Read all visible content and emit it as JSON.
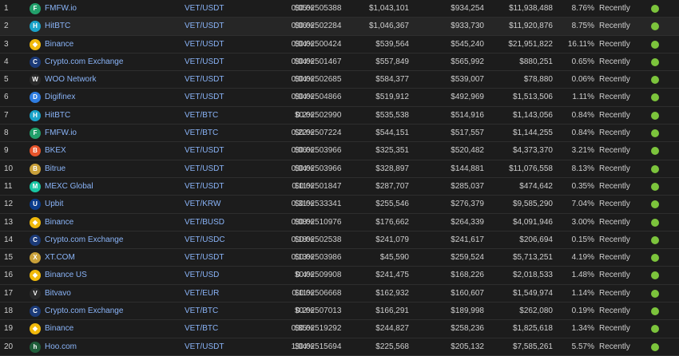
{
  "colors": {
    "accent_link": "#8ab4f8",
    "trust_green": "#7cc43c",
    "background": "#1c1c1c"
  },
  "rows": [
    {
      "rank": "1",
      "exchange": "FMFW.io",
      "icon": "fmfw-icon",
      "icon_color": "#22a06b",
      "icon_glyph": "F",
      "pair": "VET/USDT",
      "price": "$0.02505388",
      "spread": "0.05%",
      "depth_plus": "$1,043,101",
      "depth_minus": "$934,254",
      "volume": "$11,938,488",
      "volume_pct": "8.76%",
      "updated": "Recently"
    },
    {
      "rank": "2",
      "exchange": "HitBTC",
      "icon": "hitbtc-icon",
      "icon_color": "#1aa3c9",
      "icon_glyph": "H",
      "pair": "VET/USDT",
      "price": "$0.02502284",
      "spread": "0.06%",
      "depth_plus": "$1,046,367",
      "depth_minus": "$933,730",
      "volume": "$11,920,876",
      "volume_pct": "8.75%",
      "updated": "Recently"
    },
    {
      "rank": "3",
      "exchange": "Binance",
      "icon": "binance-icon",
      "icon_color": "#f0b90b",
      "icon_glyph": "◆",
      "pair": "VET/USDT",
      "price": "$0.02500424",
      "spread": "0.04%",
      "depth_plus": "$539,564",
      "depth_minus": "$545,240",
      "volume": "$21,951,822",
      "volume_pct": "16.11%",
      "updated": "Recently"
    },
    {
      "rank": "4",
      "exchange": "Crypto.com Exchange",
      "icon": "cryptocom-icon",
      "icon_color": "#1b3a78",
      "icon_glyph": "C",
      "pair": "VET/USDT",
      "price": "$0.02501467",
      "spread": "0.04%",
      "depth_plus": "$557,849",
      "depth_minus": "$565,992",
      "volume": "$880,251",
      "volume_pct": "0.65%",
      "updated": "Recently"
    },
    {
      "rank": "5",
      "exchange": "WOO Network",
      "icon": "woo-icon",
      "icon_color": "#2a2a2a",
      "icon_glyph": "W",
      "pair": "VET/USDT",
      "price": "$0.02502685",
      "spread": "0.04%",
      "depth_plus": "$584,377",
      "depth_minus": "$539,007",
      "volume": "$78,880",
      "volume_pct": "0.06%",
      "updated": "Recently"
    },
    {
      "rank": "6",
      "exchange": "Digifinex",
      "icon": "digifinex-icon",
      "icon_color": "#2f7de1",
      "icon_glyph": "D",
      "pair": "VET/USDT",
      "price": "$0.02504866",
      "spread": "0.04%",
      "depth_plus": "$519,912",
      "depth_minus": "$492,969",
      "volume": "$1,513,506",
      "volume_pct": "1.11%",
      "updated": "Recently"
    },
    {
      "rank": "7",
      "exchange": "HitBTC",
      "icon": "hitbtc-icon",
      "icon_color": "#1aa3c9",
      "icon_glyph": "H",
      "pair": "VET/BTC",
      "price": "$0.02502990",
      "spread": "0.2%",
      "depth_plus": "$535,538",
      "depth_minus": "$514,916",
      "volume": "$1,143,056",
      "volume_pct": "0.84%",
      "updated": "Recently"
    },
    {
      "rank": "8",
      "exchange": "FMFW.io",
      "icon": "fmfw-icon",
      "icon_color": "#22a06b",
      "icon_glyph": "F",
      "pair": "VET/BTC",
      "price": "$0.02507224",
      "spread": "0.22%",
      "depth_plus": "$544,151",
      "depth_minus": "$517,557",
      "volume": "$1,144,255",
      "volume_pct": "0.84%",
      "updated": "Recently"
    },
    {
      "rank": "9",
      "exchange": "BKEX",
      "icon": "bkex-icon",
      "icon_color": "#e8542b",
      "icon_glyph": "B",
      "pair": "VET/USDT",
      "price": "$0.02503966",
      "spread": "0.06%",
      "depth_plus": "$325,351",
      "depth_minus": "$520,482",
      "volume": "$4,373,370",
      "volume_pct": "3.21%",
      "updated": "Recently"
    },
    {
      "rank": "10",
      "exchange": "Bitrue",
      "icon": "bitrue-icon",
      "icon_color": "#c9a13a",
      "icon_glyph": "B",
      "pair": "VET/USDT",
      "price": "$0.02503966",
      "spread": "0.04%",
      "depth_plus": "$328,897",
      "depth_minus": "$144,881",
      "volume": "$11,076,558",
      "volume_pct": "8.13%",
      "updated": "Recently"
    },
    {
      "rank": "11",
      "exchange": "MEXC Global",
      "icon": "mexc-icon",
      "icon_color": "#19c7a4",
      "icon_glyph": "M",
      "pair": "VET/USDT",
      "price": "$0.02501847",
      "spread": "0.11%",
      "depth_plus": "$287,707",
      "depth_minus": "$285,037",
      "volume": "$474,642",
      "volume_pct": "0.35%",
      "updated": "Recently"
    },
    {
      "rank": "12",
      "exchange": "Upbit",
      "icon": "upbit-icon",
      "icon_color": "#0a3c8c",
      "icon_glyph": "U",
      "pair": "VET/KRW",
      "price": "$0.02533341",
      "spread": "0.31%",
      "depth_plus": "$255,546",
      "depth_minus": "$276,379",
      "volume": "$9,585,290",
      "volume_pct": "7.04%",
      "updated": "Recently"
    },
    {
      "rank": "13",
      "exchange": "Binance",
      "icon": "binance-icon",
      "icon_color": "#f0b90b",
      "icon_glyph": "◆",
      "pair": "VET/BUSD",
      "price": "$0.02510976",
      "spread": "0.08%",
      "depth_plus": "$176,662",
      "depth_minus": "$264,339",
      "volume": "$4,091,946",
      "volume_pct": "3.00%",
      "updated": "Recently"
    },
    {
      "rank": "14",
      "exchange": "Crypto.com Exchange",
      "icon": "cryptocom-icon",
      "icon_color": "#1b3a78",
      "icon_glyph": "C",
      "pair": "VET/USDC",
      "price": "$0.02502538",
      "spread": "0.18%",
      "depth_plus": "$241,079",
      "depth_minus": "$241,617",
      "volume": "$206,694",
      "volume_pct": "0.15%",
      "updated": "Recently"
    },
    {
      "rank": "15",
      "exchange": "XT.COM",
      "icon": "xtcom-icon",
      "icon_color": "#c9a13a",
      "icon_glyph": "X",
      "pair": "VET/USDT",
      "price": "$0.02503986",
      "spread": "0.13%",
      "depth_plus": "$45,590",
      "depth_minus": "$259,524",
      "volume": "$5,713,251",
      "volume_pct": "4.19%",
      "updated": "Recently"
    },
    {
      "rank": "16",
      "exchange": "Binance US",
      "icon": "binance-us-icon",
      "icon_color": "#f0b90b",
      "icon_glyph": "◆",
      "pair": "VET/USD",
      "price": "$0.02509908",
      "spread": "0.4%",
      "depth_plus": "$241,475",
      "depth_minus": "$168,226",
      "volume": "$2,018,533",
      "volume_pct": "1.48%",
      "updated": "Recently"
    },
    {
      "rank": "17",
      "exchange": "Bitvavo",
      "icon": "bitvavo-icon",
      "icon_color": "#2a2a2a",
      "icon_glyph": "V",
      "pair": "VET/EUR",
      "price": "$0.02506668",
      "spread": "0.11%",
      "depth_plus": "$162,932",
      "depth_minus": "$160,607",
      "volume": "$1,549,974",
      "volume_pct": "1.14%",
      "updated": "Recently"
    },
    {
      "rank": "18",
      "exchange": "Crypto.com Exchange",
      "icon": "cryptocom-icon",
      "icon_color": "#1b3a78",
      "icon_glyph": "C",
      "pair": "VET/BTC",
      "price": "$0.02507013",
      "spread": "0.2%",
      "depth_plus": "$166,291",
      "depth_minus": "$189,998",
      "volume": "$262,080",
      "volume_pct": "0.19%",
      "updated": "Recently"
    },
    {
      "rank": "19",
      "exchange": "Binance",
      "icon": "binance-icon",
      "icon_color": "#f0b90b",
      "icon_glyph": "◆",
      "pair": "VET/BTC",
      "price": "$0.02519292",
      "spread": "0.85%",
      "depth_plus": "$244,827",
      "depth_minus": "$258,236",
      "volume": "$1,825,618",
      "volume_pct": "1.34%",
      "updated": "Recently"
    },
    {
      "rank": "20",
      "exchange": "Hoo.com",
      "icon": "hoo-icon",
      "icon_color": "#1f5e3a",
      "icon_glyph": "h",
      "pair": "VET/USDT",
      "price": "$0.02515694",
      "spread": "1.04%",
      "depth_plus": "$225,568",
      "depth_minus": "$205,132",
      "volume": "$7,585,261",
      "volume_pct": "5.57%",
      "updated": "Recently"
    }
  ]
}
